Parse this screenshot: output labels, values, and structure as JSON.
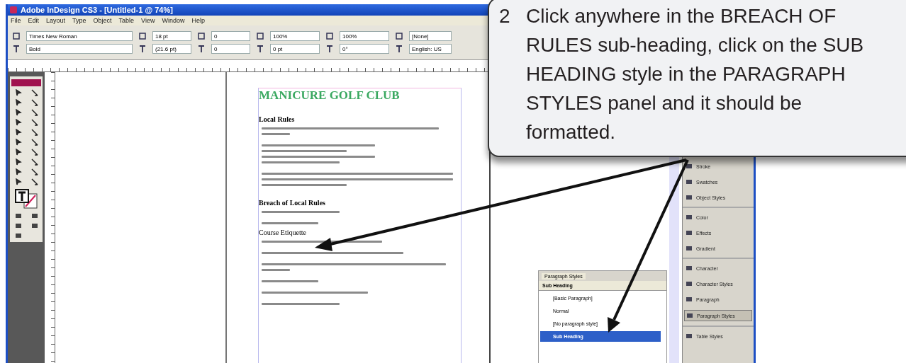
{
  "window": {
    "title": "Adobe InDesign CS3 - [Untitled-1 @ 74%]"
  },
  "menu": [
    "File",
    "Edit",
    "Layout",
    "Type",
    "Object",
    "Table",
    "View",
    "Window",
    "Help"
  ],
  "control_panel": {
    "row_1": [
      "Times New Roman",
      "18 pt",
      "0",
      "100%",
      "100%",
      "[None]"
    ],
    "row_2": [
      "Bold",
      "(21.6 pt)",
      "0",
      "0 pt",
      "0°",
      "English: US"
    ]
  },
  "document": {
    "title": "MANICURE GOLF CLUB",
    "sections": [
      {
        "heading": "Local Rules",
        "kind": "subheading"
      },
      {
        "heading": "Breach of Local Rules",
        "kind": "subheading"
      },
      {
        "heading": "Course Etiquette",
        "kind": "plain"
      }
    ]
  },
  "dock_groups": [
    {
      "items": [
        {
          "label": "Stroke",
          "selected": false
        },
        {
          "label": "Swatches",
          "selected": false
        },
        {
          "label": "Object Styles",
          "selected": false
        }
      ]
    },
    {
      "items": [
        {
          "label": "Color",
          "selected": false
        },
        {
          "label": "Effects",
          "selected": false
        },
        {
          "label": "Gradient",
          "selected": false
        }
      ]
    },
    {
      "items": [
        {
          "label": "Character",
          "selected": false
        },
        {
          "label": "Character Styles",
          "selected": false
        },
        {
          "label": "Paragraph",
          "selected": false
        },
        {
          "label": "Paragraph Styles",
          "selected": true
        }
      ]
    },
    {
      "items": [
        {
          "label": "Table Styles",
          "selected": false
        }
      ]
    }
  ],
  "paragraph_styles_panel": {
    "tab": "Paragraph Styles",
    "current_style": "Sub Heading",
    "styles": [
      {
        "label": "[Basic Paragraph]",
        "selected": false
      },
      {
        "label": "Normal",
        "selected": false
      },
      {
        "label": "[No paragraph style]",
        "selected": false
      },
      {
        "label": "Sub Heading",
        "selected": true
      }
    ]
  },
  "callout": {
    "step": "2",
    "text": "Click anywhere in the BREACH OF RULES sub-heading, click on the SUB HEADING style in the PARAGRAPH STYLES panel and it should be formatted."
  }
}
